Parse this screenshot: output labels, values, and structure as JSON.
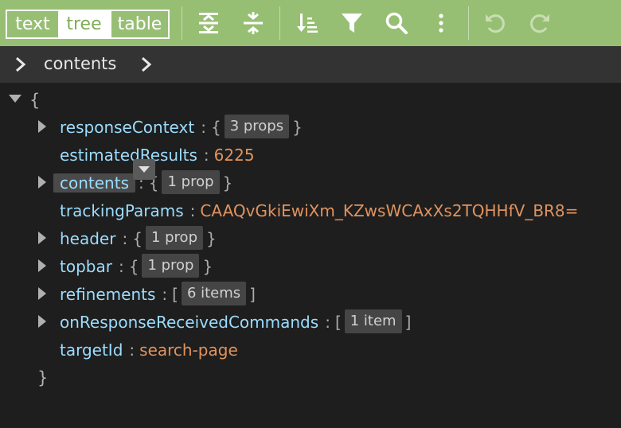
{
  "toolbar": {
    "modes": [
      "text",
      "tree",
      "table"
    ],
    "active_mode": "tree",
    "icons": [
      "expand-all-icon",
      "collapse-all-icon",
      "sort-icon",
      "filter-icon",
      "search-icon",
      "more-vertical-icon",
      "undo-icon",
      "redo-icon"
    ],
    "colors": {
      "background": "#97bf73",
      "active_text": "#7fae55"
    }
  },
  "navbar": {
    "path": "contents"
  },
  "tree": {
    "open_brace": "{",
    "close_brace": "}",
    "rows": [
      {
        "key": "responseContext",
        "open": "{",
        "badge": "3 props",
        "close": "}",
        "expandable": true
      },
      {
        "key": "estimatedResults",
        "value": "6225",
        "value_type": "number",
        "expandable": false
      },
      {
        "key": "contents",
        "open": "{",
        "badge": "1 prop",
        "close": "}",
        "expandable": true,
        "selected": true
      },
      {
        "key": "trackingParams",
        "value": "CAAQvGkiEwiXm_KZwsWCAxXs2TQHHfV_BR8=",
        "value_type": "string",
        "expandable": false
      },
      {
        "key": "header",
        "open": "{",
        "badge": "1 prop",
        "close": "}",
        "expandable": true
      },
      {
        "key": "topbar",
        "open": "{",
        "badge": "1 prop",
        "close": "}",
        "expandable": true
      },
      {
        "key": "refinements",
        "open": "[",
        "badge": "6 items",
        "close": "]",
        "expandable": true
      },
      {
        "key": "onResponseReceivedCommands",
        "open": "[",
        "badge": "1 item",
        "close": "]",
        "expandable": true
      },
      {
        "key": "targetId",
        "value": "search-page",
        "value_type": "string",
        "expandable": false
      }
    ],
    "separator": ":"
  },
  "colors": {
    "key": "#9cdcfe",
    "value": "#e0935f",
    "badge_bg": "#454545"
  }
}
